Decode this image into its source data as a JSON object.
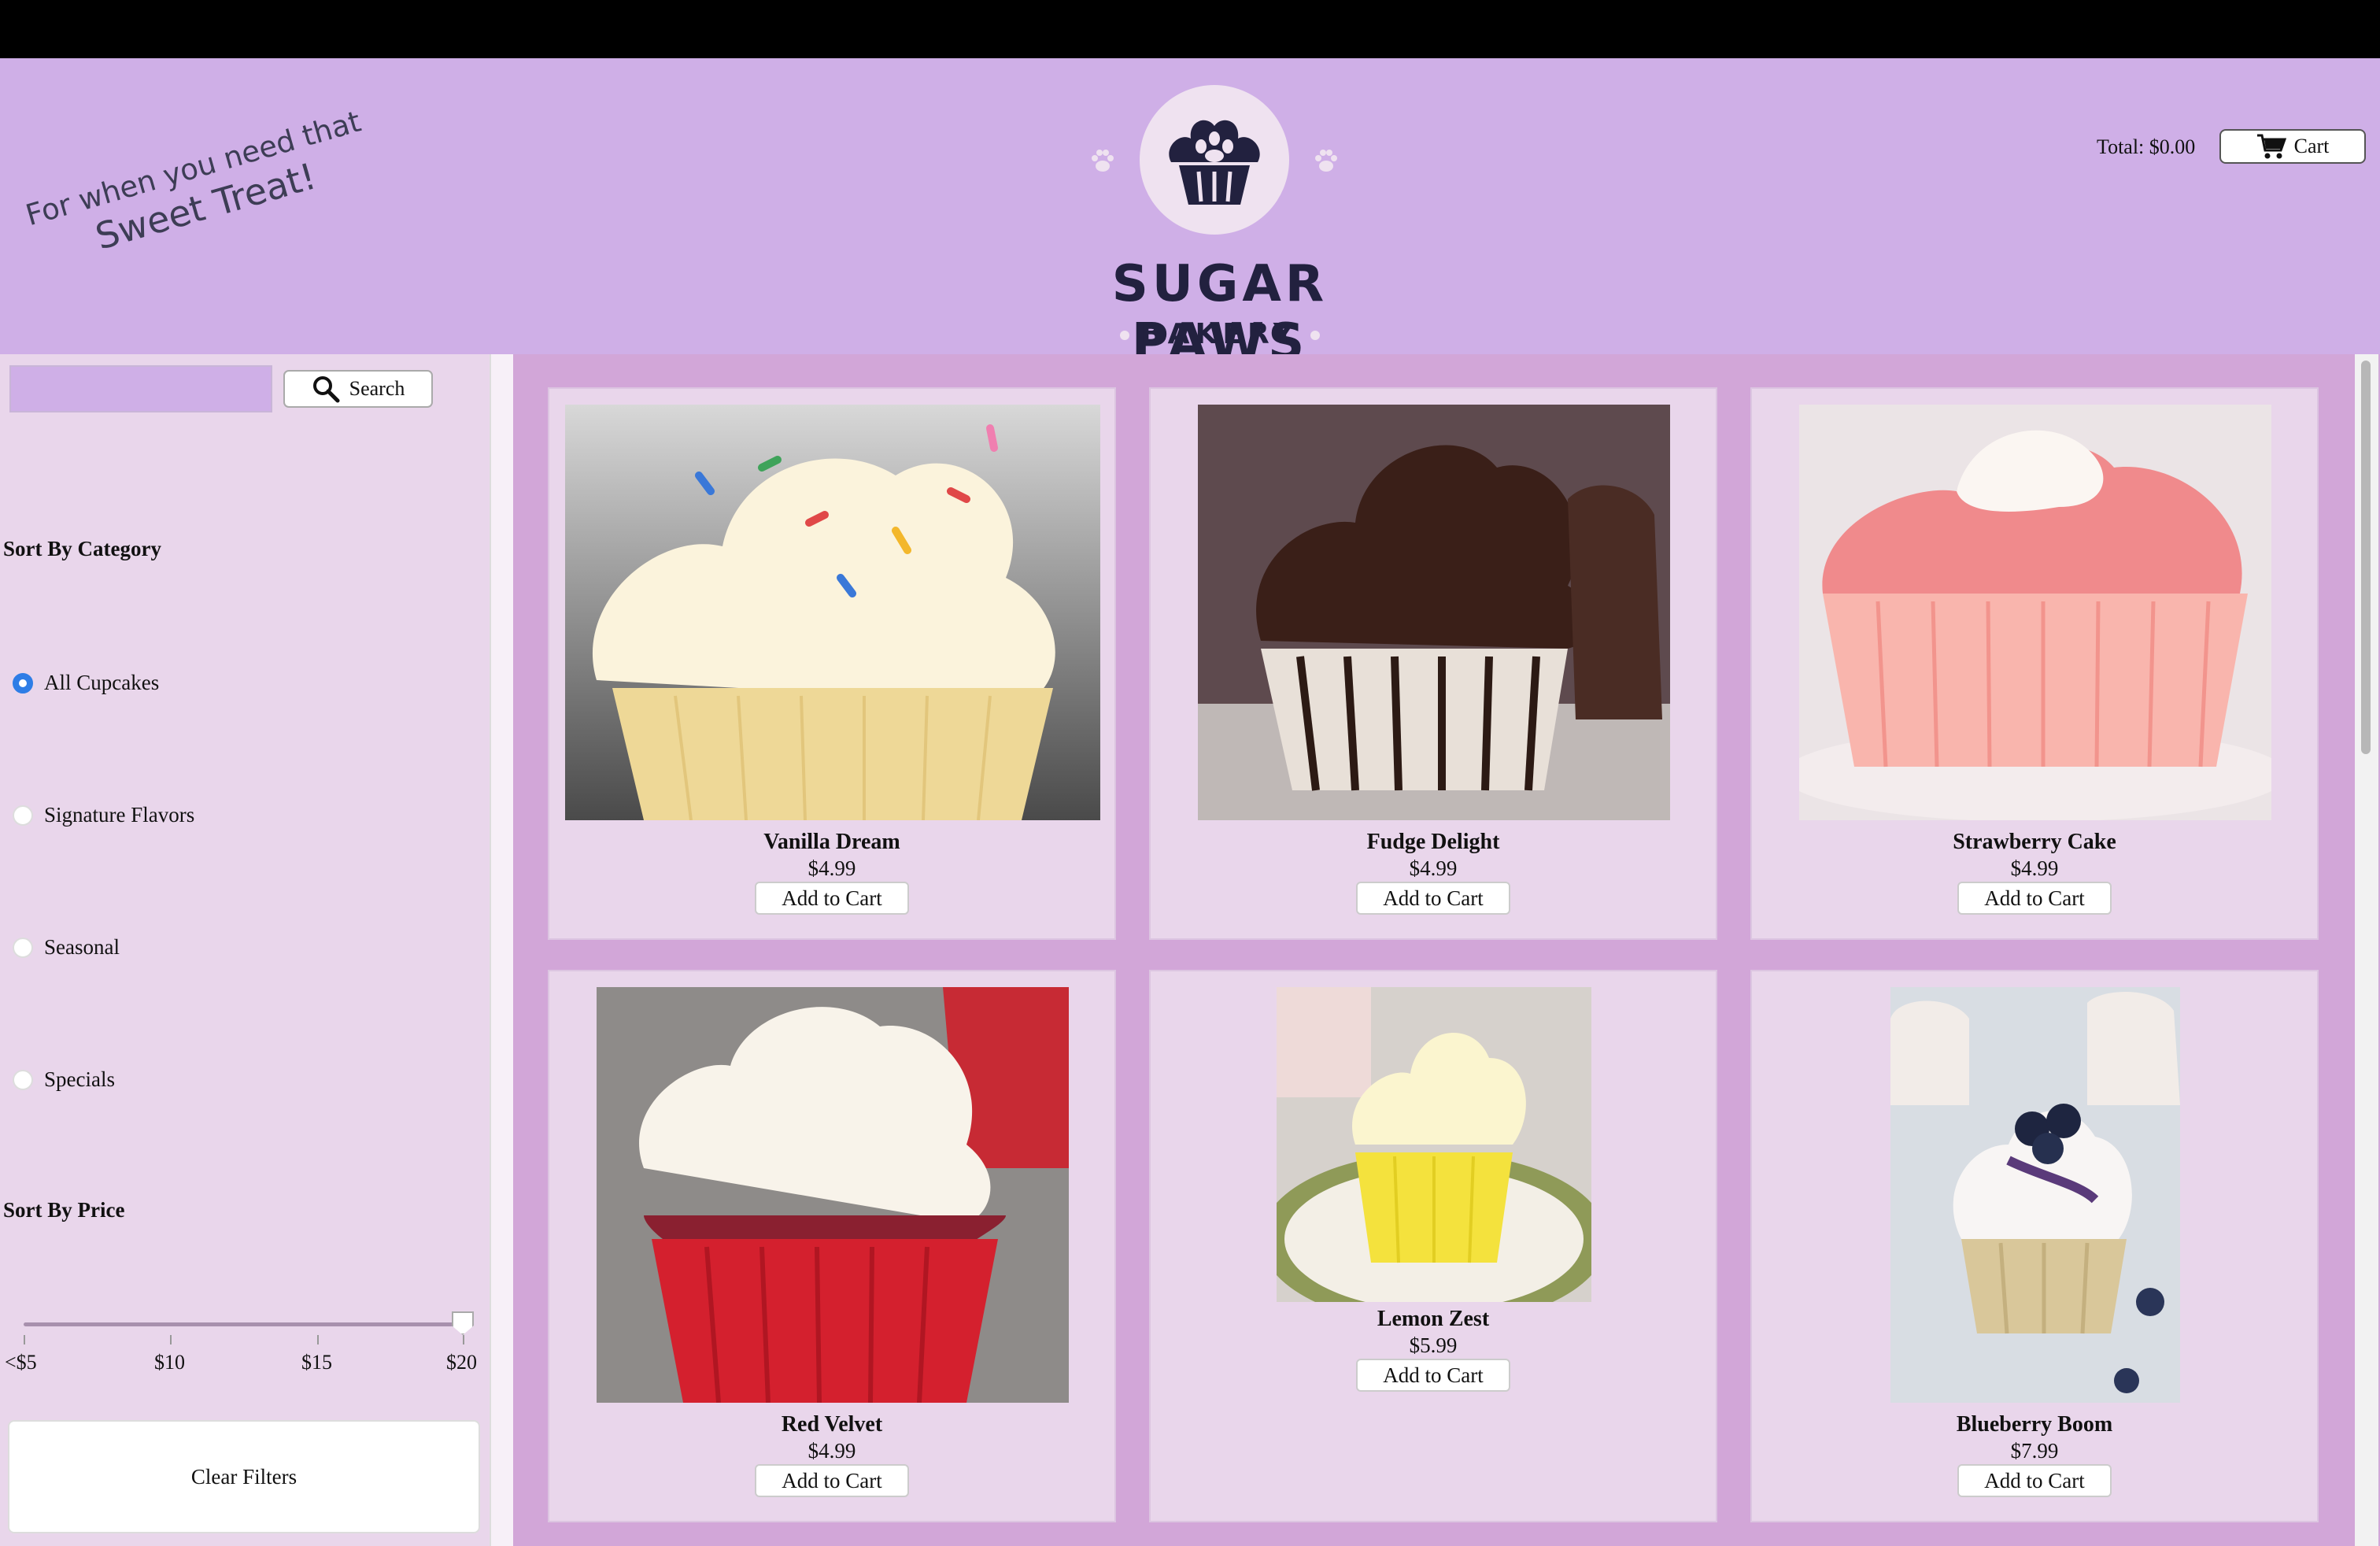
{
  "header": {
    "tagline_line1": "For when you need that",
    "tagline_line2": "Sweet Treat!",
    "brand_name": "SUGAR PAWS",
    "brand_sub": "BAKERY",
    "total_label": "Total: $0.00",
    "cart_label": "Cart",
    "colors": {
      "header_bg": "#cfafe7",
      "brand": "#22213f"
    }
  },
  "sidebar": {
    "search": {
      "value": "",
      "button_label": "Search",
      "icon": "search-icon"
    },
    "category_title": "Sort By Category",
    "categories": [
      {
        "label": "All Cupcakes",
        "checked": true
      },
      {
        "label": "Signature Flavors",
        "checked": false
      },
      {
        "label": "Seasonal",
        "checked": false
      },
      {
        "label": "Specials",
        "checked": false
      }
    ],
    "price_title": "Sort By Price",
    "price_ticks": [
      "<$5",
      "$10",
      "$15",
      "$20"
    ],
    "price_value": "$20",
    "clear_label": "Clear Filters"
  },
  "products": [
    {
      "name": "Vanilla Dream",
      "price": "$4.99",
      "button": "Add to Cart"
    },
    {
      "name": "Fudge Delight",
      "price": "$4.99",
      "button": "Add to Cart"
    },
    {
      "name": "Strawberry Cake",
      "price": "$4.99",
      "button": "Add to Cart"
    },
    {
      "name": "Red Velvet",
      "price": "$4.99",
      "button": "Add to Cart"
    },
    {
      "name": "Lemon Zest",
      "price": "$5.99",
      "button": "Add to Cart"
    },
    {
      "name": "Blueberry Boom",
      "price": "$7.99",
      "button": "Add to Cart"
    }
  ]
}
